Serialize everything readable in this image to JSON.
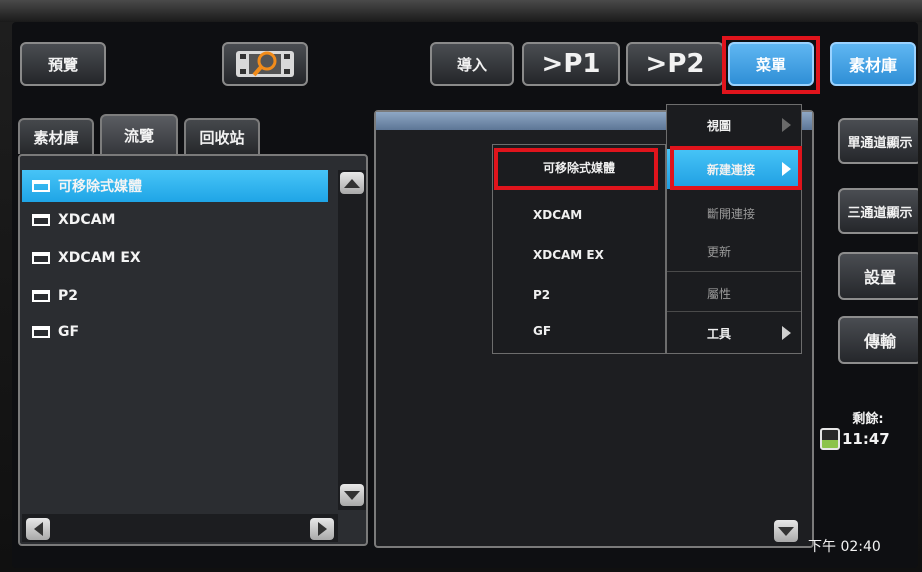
{
  "toolbar": {
    "preview_label": "預覽",
    "import_label": "導入",
    "p1_label": ">P1",
    "p2_label": ">P2",
    "menu_label": "菜單",
    "library_label": "素材庫"
  },
  "tabs": [
    {
      "label": "素材庫",
      "active": false
    },
    {
      "label": "流覽",
      "active": true
    },
    {
      "label": "回收站",
      "active": false
    }
  ],
  "folders": [
    {
      "label": "可移除式媒體",
      "selected": true
    },
    {
      "label": "XDCAM",
      "selected": false
    },
    {
      "label": "XDCAM EX",
      "selected": false
    },
    {
      "label": "P2",
      "selected": false
    },
    {
      "label": "GF",
      "selected": false
    }
  ],
  "main_menu": {
    "items": [
      {
        "label": "視圖",
        "submenu": true,
        "enabled": true
      },
      {
        "label": "新建連接",
        "submenu": true,
        "enabled": true,
        "highlighted": true
      },
      {
        "label": "斷開連接",
        "submenu": false,
        "enabled": false
      },
      {
        "label": "更新",
        "submenu": false,
        "enabled": false
      },
      {
        "label": "屬性",
        "submenu": false,
        "enabled": false
      },
      {
        "label": "工具",
        "submenu": true,
        "enabled": true
      }
    ]
  },
  "connect_submenu": {
    "items": [
      {
        "label": "可移除式媒體"
      },
      {
        "label": "XDCAM"
      },
      {
        "label": "XDCAM EX"
      },
      {
        "label": "P2"
      },
      {
        "label": "GF"
      }
    ]
  },
  "sidebar": {
    "single_channel_label": "單通道顯示",
    "three_channel_label": "三通道顯示",
    "settings_label": "設置",
    "transfer_label": "傳輸",
    "remaining_label": "剩餘:",
    "remaining_time": "11:47"
  },
  "clock": "下午 02:40",
  "colors": {
    "accent_blue": "#2f9ee2",
    "highlight_red": "#e0141c",
    "battery_green": "#8bc34a"
  },
  "icons": {
    "preview_icon": "film-magnifier-icon",
    "folder_icon": "folder-icon",
    "battery_icon": "battery-icon"
  }
}
